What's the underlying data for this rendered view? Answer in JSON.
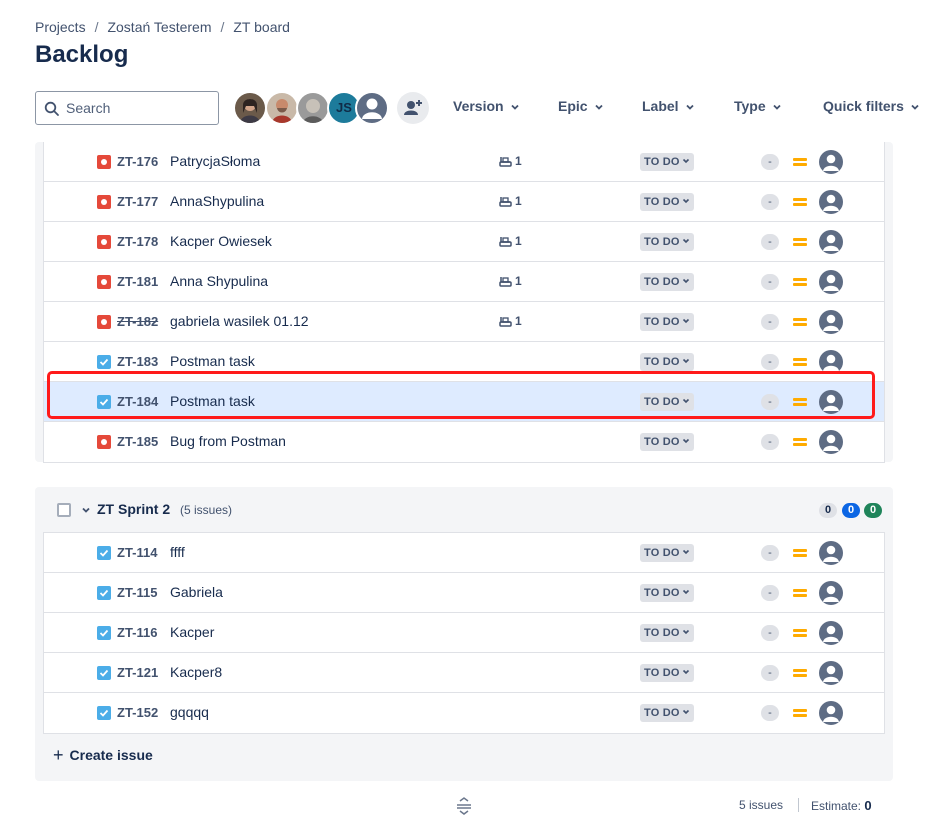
{
  "breadcrumb": {
    "items": [
      "Projects",
      "Zostań Testerem",
      "ZT board"
    ],
    "separator": "/"
  },
  "page_title": "Backlog",
  "search": {
    "placeholder": "Search",
    "value": ""
  },
  "avatars": [
    {
      "name": "user-avatar-1"
    },
    {
      "name": "user-avatar-2"
    },
    {
      "name": "user-avatar-3"
    },
    {
      "initials": "JS"
    },
    {
      "name": "unassigned-avatar"
    }
  ],
  "filters": [
    "Version",
    "Epic",
    "Label",
    "Type",
    "Quick filters"
  ],
  "sprint1_rows": [
    {
      "type": "bug",
      "key": "ZT-176",
      "summary": "PatrycjaSłoma",
      "child_count": "1",
      "status": "TO DO",
      "estimate": "-",
      "priority": "medium",
      "done": false
    },
    {
      "type": "bug",
      "key": "ZT-177",
      "summary": "AnnaShypulina",
      "child_count": "1",
      "status": "TO DO",
      "estimate": "-",
      "priority": "medium",
      "done": false
    },
    {
      "type": "bug",
      "key": "ZT-178",
      "summary": "Kacper Owiesek",
      "child_count": "1",
      "status": "TO DO",
      "estimate": "-",
      "priority": "medium",
      "done": false
    },
    {
      "type": "bug",
      "key": "ZT-181",
      "summary": "Anna Shypulina",
      "child_count": "1",
      "status": "TO DO",
      "estimate": "-",
      "priority": "medium",
      "done": false
    },
    {
      "type": "bug",
      "key": "ZT-182",
      "summary": "gabriela wasilek 01.12",
      "child_count": "1",
      "status": "TO DO",
      "estimate": "-",
      "priority": "medium",
      "done": true
    },
    {
      "type": "task",
      "key": "ZT-183",
      "summary": "Postman task",
      "child_count": "",
      "status": "TO DO",
      "estimate": "-",
      "priority": "medium",
      "done": false
    },
    {
      "type": "task",
      "key": "ZT-184",
      "summary": "Postman task",
      "child_count": "",
      "status": "TO DO",
      "estimate": "-",
      "priority": "medium",
      "done": false,
      "selected": true
    },
    {
      "type": "bug",
      "key": "ZT-185",
      "summary": "Bug from Postman",
      "child_count": "",
      "status": "TO DO",
      "estimate": "-",
      "priority": "medium",
      "done": false
    }
  ],
  "sprint2": {
    "name": "ZT Sprint 2",
    "issue_count": "(5 issues)",
    "counts": {
      "todo": "0",
      "in_progress": "0",
      "done": "0"
    },
    "rows": [
      {
        "type": "task",
        "key": "ZT-114",
        "summary": "ffff",
        "status": "TO DO",
        "estimate": "-",
        "priority": "medium"
      },
      {
        "type": "task",
        "key": "ZT-115",
        "summary": "Gabriela",
        "status": "TO DO",
        "estimate": "-",
        "priority": "medium"
      },
      {
        "type": "task",
        "key": "ZT-116",
        "summary": "Kacper",
        "status": "TO DO",
        "estimate": "-",
        "priority": "medium"
      },
      {
        "type": "task",
        "key": "ZT-121",
        "summary": "Kacper8",
        "status": "TO DO",
        "estimate": "-",
        "priority": "medium"
      },
      {
        "type": "task",
        "key": "ZT-152",
        "summary": "gqqqq",
        "status": "TO DO",
        "estimate": "-",
        "priority": "medium"
      }
    ],
    "create_label": "Create issue"
  },
  "footer": {
    "issues": "5 issues",
    "estimate_label": "Estimate:",
    "estimate_value": "0"
  },
  "colors": {
    "bug": "#e5493a",
    "task": "#4bade8",
    "selected_row": "#deebff",
    "highlight": "#ff1a1a",
    "priority_medium": "#ffab00"
  }
}
